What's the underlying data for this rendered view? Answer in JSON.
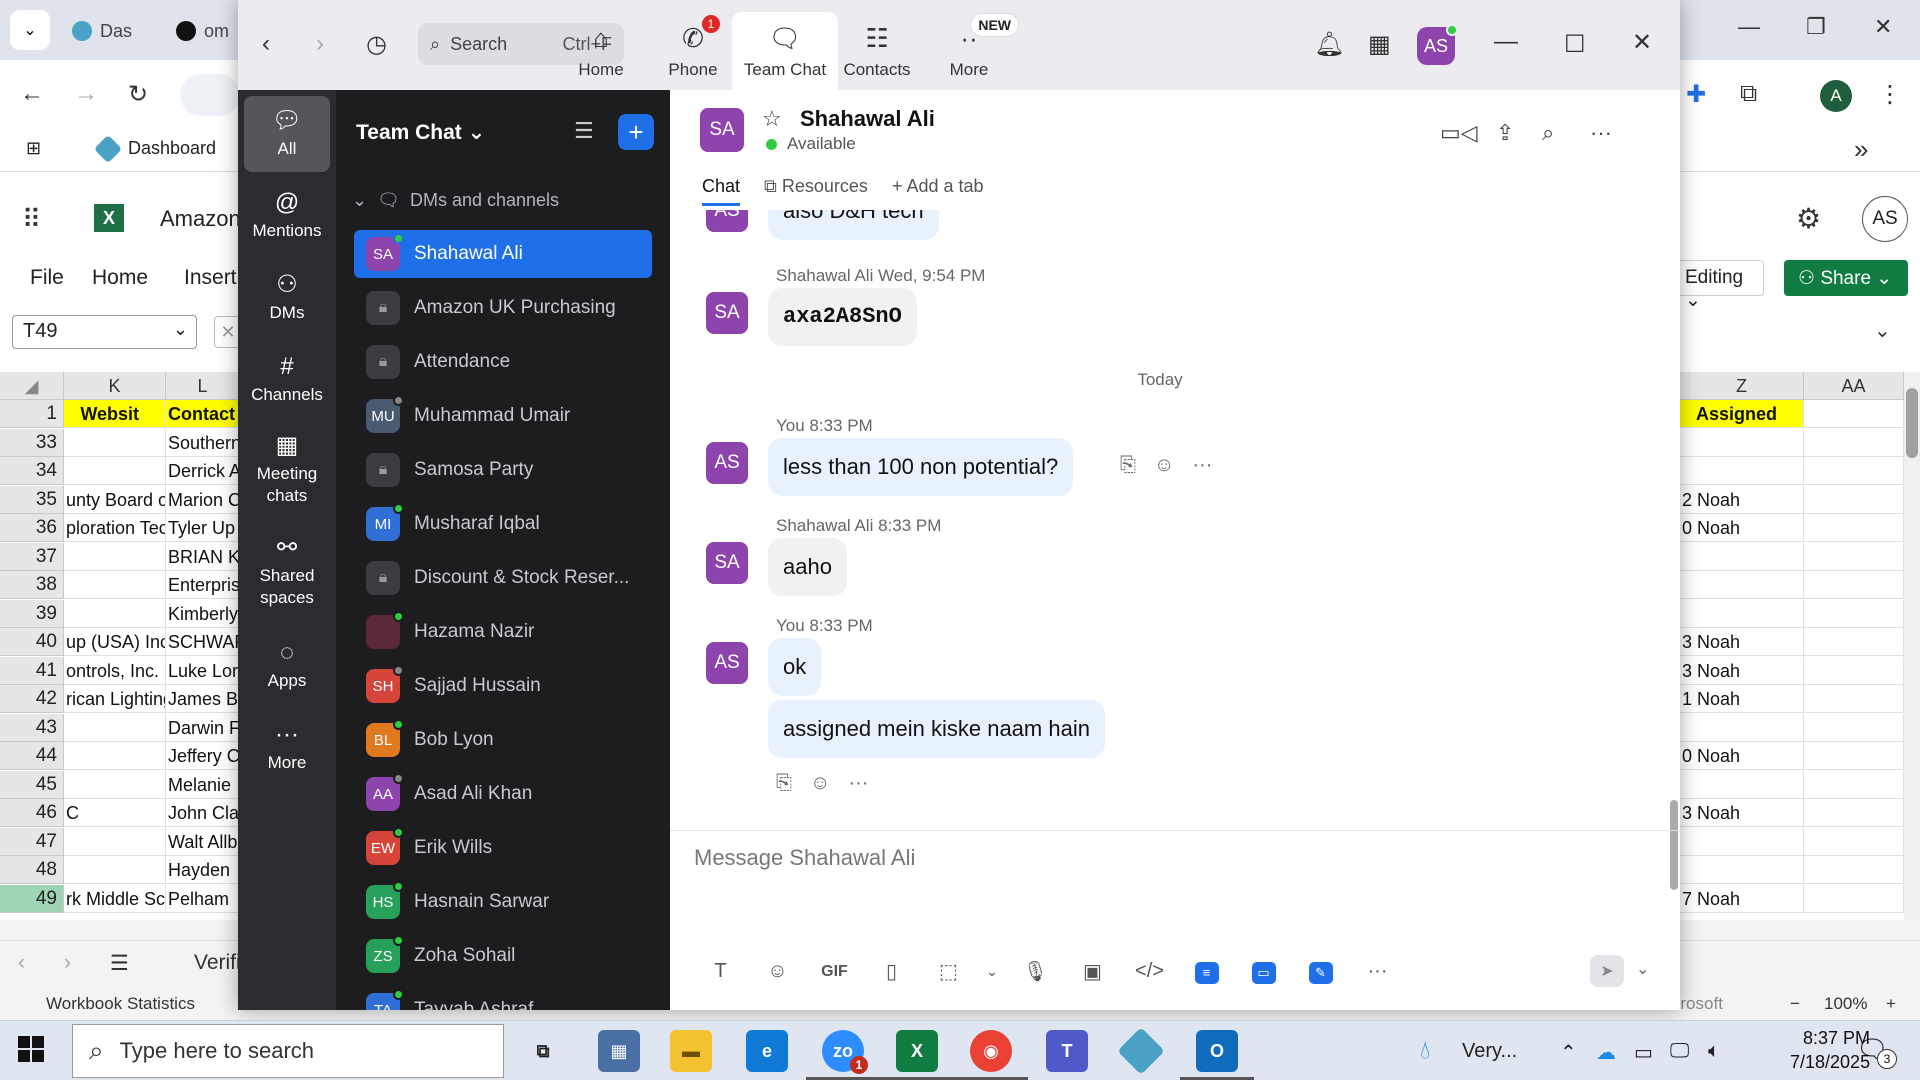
{
  "browser": {
    "tabs": [
      {
        "label": "Das",
        "color": "#4aa3c7"
      },
      {
        "label": "om",
        "color": "#111111"
      }
    ],
    "bookmark": "Dashboard"
  },
  "excel": {
    "doc_title": "Amazon",
    "menu": [
      "File",
      "Home",
      "Insert"
    ],
    "name_box": "T49",
    "editing_label": "Editing",
    "share_label": "Share",
    "avatar_initials": "AS",
    "columns_left": [
      "K",
      "L"
    ],
    "columns_right": [
      "Z",
      "AA"
    ],
    "header_row": {
      "num": "1",
      "K": "Websit",
      "L": "Contact N",
      "Z": "Assigned"
    },
    "rows": [
      {
        "num": "33",
        "K": "",
        "L": "Southern",
        "Z": ""
      },
      {
        "num": "34",
        "K": "",
        "L": "Derrick A",
        "Z": ""
      },
      {
        "num": "35",
        "K": "unty Board of",
        "L": "Marion C",
        "Z": "2 Noah"
      },
      {
        "num": "36",
        "K": "ploration Tech",
        "L": "Tyler Up",
        "Z": "0 Noah"
      },
      {
        "num": "37",
        "K": "",
        "L": "BRIAN K",
        "Z": ""
      },
      {
        "num": "38",
        "K": "",
        "L": "Enterpris",
        "Z": ""
      },
      {
        "num": "39",
        "K": "",
        "L": "Kimberly",
        "Z": ""
      },
      {
        "num": "40",
        "K": "up (USA) Inc",
        "L": "SCHWAR",
        "Z": "3 Noah"
      },
      {
        "num": "41",
        "K": "ontrols, Inc.",
        "L": "Luke Lor",
        "Z": "3 Noah"
      },
      {
        "num": "42",
        "K": "rican Lighting",
        "L": "James B",
        "Z": "1 Noah"
      },
      {
        "num": "43",
        "K": "",
        "L": "Darwin F",
        "Z": ""
      },
      {
        "num": "44",
        "K": "",
        "L": "Jeffery C",
        "Z": "0 Noah"
      },
      {
        "num": "45",
        "K": "",
        "L": "Melanie",
        "Z": ""
      },
      {
        "num": "46",
        "K": "C",
        "L": "John Cla",
        "Z": "3 Noah"
      },
      {
        "num": "47",
        "K": "",
        "L": "Walt Allb",
        "Z": ""
      },
      {
        "num": "48",
        "K": "",
        "L": "Hayden",
        "Z": ""
      },
      {
        "num": "49",
        "K": "rk Middle Sc",
        "L": "Pelham",
        "Z": "7 Noah"
      }
    ],
    "sheet_name": "Verified",
    "status_left": "Workbook Statistics",
    "status_right": "Give Feedback to Microsoft",
    "zoom": "100%"
  },
  "zoom_app": {
    "search": {
      "label": "Search",
      "shortcut": "Ctrl+F"
    },
    "nav_tabs": [
      {
        "label": "Home",
        "icon": "home-icon",
        "badge": ""
      },
      {
        "label": "Phone",
        "icon": "phone-icon",
        "badge": "1"
      },
      {
        "label": "Team Chat",
        "icon": "chat-icon",
        "badge": ""
      },
      {
        "label": "Contacts",
        "icon": "contacts-icon",
        "badge": ""
      },
      {
        "label": "More",
        "icon": "more-icon",
        "badge": "NEW"
      }
    ],
    "user_initials": "AS",
    "rail": [
      {
        "label": "All",
        "icon": "chat-bubble-icon"
      },
      {
        "label": "Mentions",
        "icon": "at-icon"
      },
      {
        "label": "DMs",
        "icon": "people-icon"
      },
      {
        "label": "Channels",
        "icon": "hash-icon"
      },
      {
        "label": "Meeting chats",
        "icon": "calendar-icon"
      },
      {
        "label": "Shared spaces",
        "icon": "share-icon"
      },
      {
        "label": "Apps",
        "icon": "apps-icon"
      },
      {
        "label": "More",
        "icon": "ellipsis-icon"
      }
    ],
    "list_title": "Team Chat",
    "section_label": "DMs and channels",
    "chats": [
      {
        "name": "Shahawal Ali",
        "initials": "SA",
        "color": "#8e44ad",
        "lock": false,
        "presence": "#2ecc40"
      },
      {
        "name": "Amazon UK Purchasing",
        "initials": "",
        "color": "",
        "lock": true,
        "presence": ""
      },
      {
        "name": "Attendance",
        "initials": "",
        "color": "",
        "lock": true,
        "presence": ""
      },
      {
        "name": "Muhammad Umair",
        "initials": "MU",
        "color": "#4a5a70",
        "lock": false,
        "presence": "#888888"
      },
      {
        "name": "Samosa Party",
        "initials": "",
        "color": "",
        "lock": true,
        "presence": ""
      },
      {
        "name": "Musharaf Iqbal",
        "initials": "MI",
        "color": "#2f6fd6",
        "lock": false,
        "presence": "#2ecc40"
      },
      {
        "name": "Discount & Stock Reser...",
        "initials": "",
        "color": "",
        "lock": true,
        "presence": ""
      },
      {
        "name": "Hazama Nazir",
        "initials": "",
        "color": "#5a2a38",
        "lock": false,
        "presence": "#2ecc40"
      },
      {
        "name": "Sajjad Hussain",
        "initials": "SH",
        "color": "#d6453a",
        "lock": false,
        "presence": "#888888"
      },
      {
        "name": "Bob Lyon",
        "initials": "BL",
        "color": "#e07a20",
        "lock": false,
        "presence": "#2ecc40"
      },
      {
        "name": "Asad Ali Khan",
        "initials": "AA",
        "color": "#8e44ad",
        "lock": false,
        "presence": "#888888"
      },
      {
        "name": "Erik Wills",
        "initials": "EW",
        "color": "#d6453a",
        "lock": false,
        "presence": "#2ecc40"
      },
      {
        "name": "Hasnain Sarwar",
        "initials": "HS",
        "color": "#27a05a",
        "lock": false,
        "presence": "#2ecc40"
      },
      {
        "name": "Zoha Sohail",
        "initials": "ZS",
        "color": "#27a05a",
        "lock": false,
        "presence": "#2ecc40"
      },
      {
        "name": "Tayyab Ashraf",
        "initials": "TA",
        "color": "#2f6fd6",
        "lock": false,
        "presence": "#2ecc40"
      }
    ],
    "conversation": {
      "contact_name": "Shahawal Ali",
      "contact_initials": "SA",
      "status": "Available",
      "tabs": [
        "Chat",
        "Resources",
        "Add a tab"
      ],
      "messages": [
        {
          "kind": "bubble",
          "avatar": "AS",
          "text": "also D&H tech",
          "partial": true
        },
        {
          "kind": "msg",
          "avatar": "SA",
          "sender": "Shahawal Ali",
          "time": "Wed, 9:54 PM",
          "text": "axa2A8SnO",
          "bold": true
        },
        {
          "kind": "day",
          "text": "Today"
        },
        {
          "kind": "msg",
          "avatar": "AS",
          "sender": "You",
          "time": "8:33 PM",
          "text": "less than 100 non potential?"
        },
        {
          "kind": "msg",
          "avatar": "SA",
          "sender": "Shahawal Ali",
          "time": "8:33 PM",
          "text": "aaho"
        },
        {
          "kind": "msg",
          "avatar": "AS",
          "sender": "You",
          "time": "8:33 PM",
          "text": "ok"
        },
        {
          "kind": "cont",
          "text": "assigned mein kiske naam hain"
        }
      ],
      "compose_placeholder": "Message Shahawal Ali"
    }
  },
  "taskbar": {
    "search_placeholder": "Type here to search",
    "weather": "Very...",
    "time": "8:37 PM",
    "date": "7/18/2025",
    "notifications": "3",
    "zoom_badge": "1"
  }
}
